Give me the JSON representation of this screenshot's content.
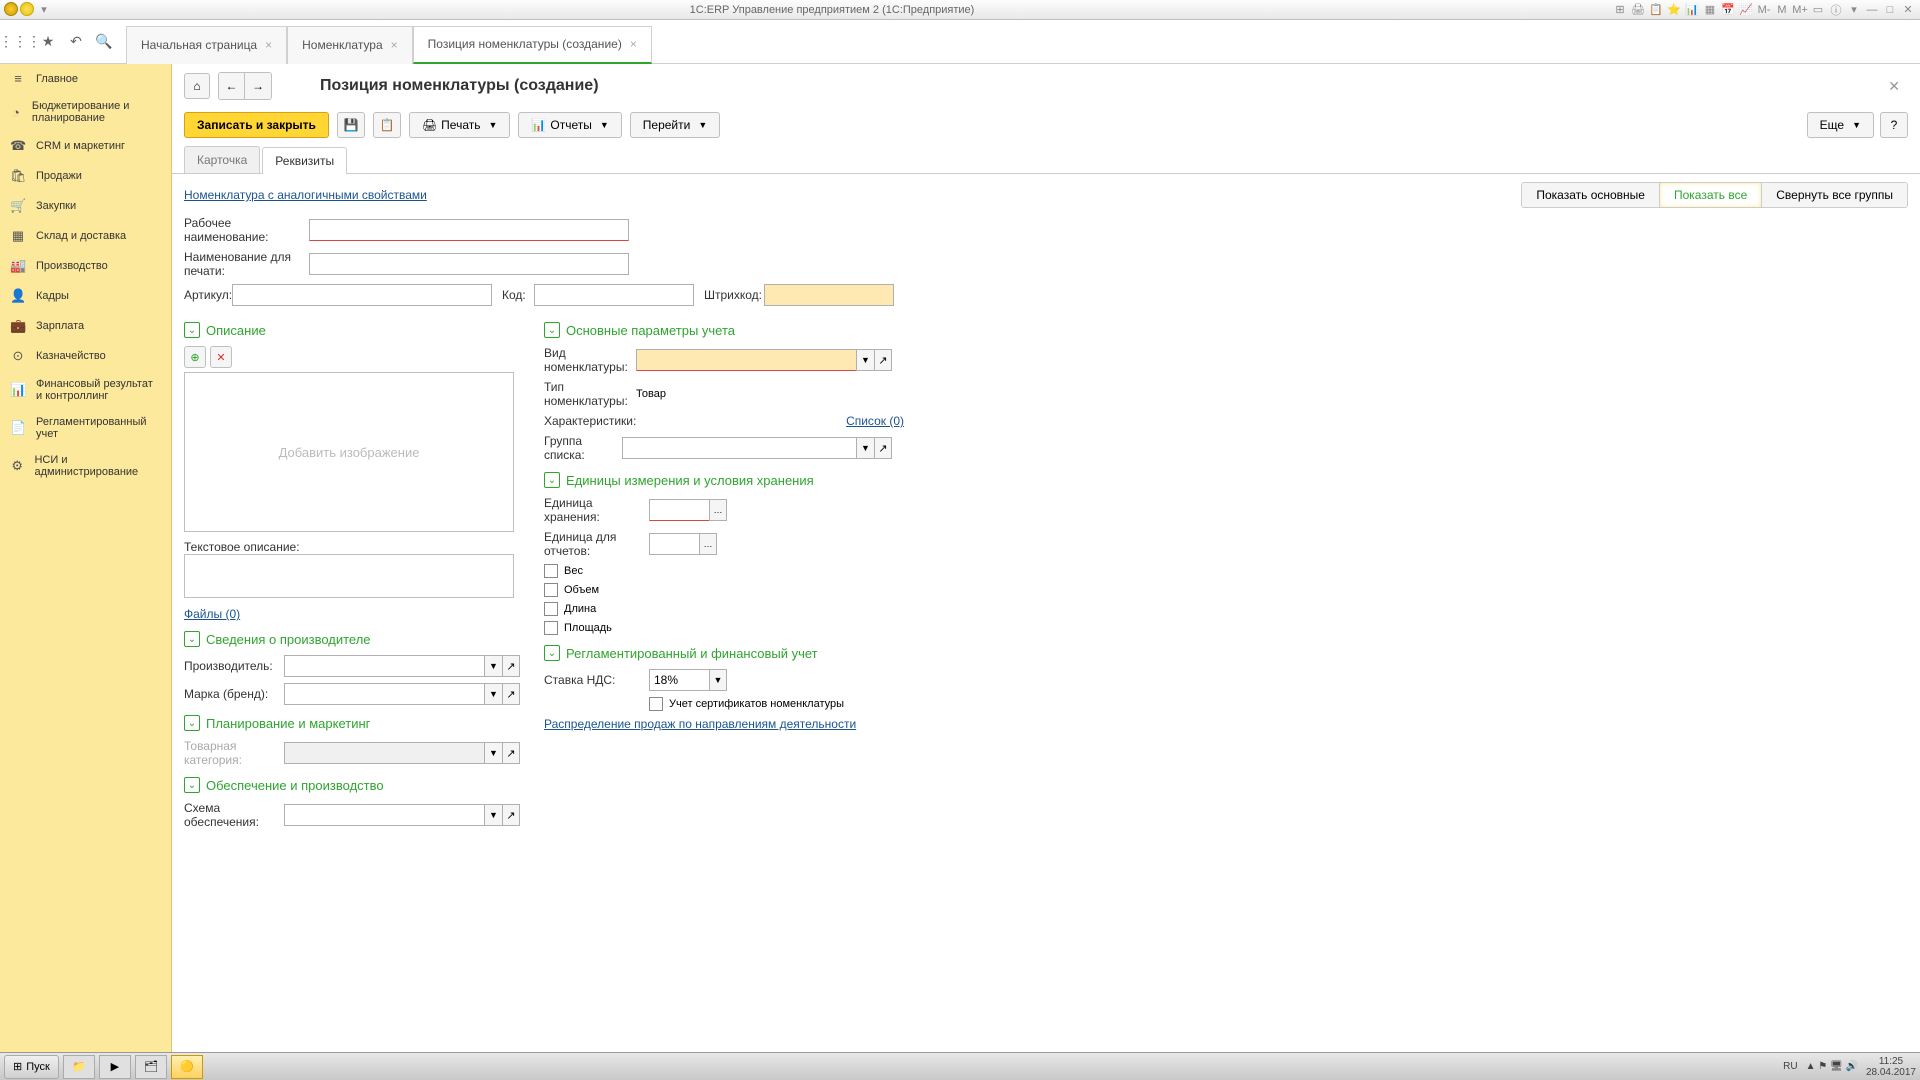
{
  "titlebar": {
    "title": "1С:ERP Управление предприятием 2  (1С:Предприятие)",
    "right_icons": [
      "⊞",
      "🖨",
      "📋",
      "⭐",
      "📊",
      "▦",
      "📅",
      "📈",
      "M-",
      "M",
      "M+",
      "▭",
      "ⓘ",
      "▾",
      "—",
      "□",
      "✕"
    ]
  },
  "iconbar_tabs": [
    {
      "label": "Начальная страница",
      "closable": true
    },
    {
      "label": "Номенклатура",
      "closable": true
    },
    {
      "label": "Позиция номенклатуры (создание)",
      "closable": true,
      "active": true
    }
  ],
  "sidebar": [
    {
      "icon": "≡",
      "label": "Главное"
    },
    {
      "icon": "◔",
      "label": "Бюджетирование и планирование"
    },
    {
      "icon": "☎",
      "label": "CRM и маркетинг"
    },
    {
      "icon": "🛍",
      "label": "Продажи"
    },
    {
      "icon": "🛒",
      "label": "Закупки"
    },
    {
      "icon": "▦",
      "label": "Склад и доставка"
    },
    {
      "icon": "🏭",
      "label": "Производство"
    },
    {
      "icon": "👤",
      "label": "Кадры"
    },
    {
      "icon": "💼",
      "label": "Зарплата"
    },
    {
      "icon": "⊙",
      "label": "Казначейство"
    },
    {
      "icon": "📊",
      "label": "Финансовый результат и контроллинг"
    },
    {
      "icon": "📄",
      "label": "Регламентированный учет"
    },
    {
      "icon": "⚙",
      "label": "НСИ и администрирование"
    }
  ],
  "page": {
    "title": "Позиция номенклатуры (создание)",
    "save_close": "Записать и закрыть",
    "print": "Печать",
    "reports": "Отчеты",
    "goto": "Перейти",
    "more": "Еще",
    "help": "?"
  },
  "subtabs": {
    "card": "Карточка",
    "req": "Реквизиты"
  },
  "toplink": "Номенклатура с аналогичными свойствами",
  "view": {
    "main": "Показать основные",
    "all": "Показать все",
    "collapse": "Свернуть все группы"
  },
  "labels": {
    "work_name": "Рабочее наименование:",
    "print_name": "Наименование для печати:",
    "article": "Артикул:",
    "code": "Код:",
    "barcode": "Штрихкод:",
    "text_desc": "Текстовое описание:",
    "files": "Файлы (0)",
    "manufacturer": "Производитель:",
    "brand": "Марка (бренд):",
    "category": "Товарная категория:",
    "supply": "Схема обеспечения:",
    "kind": "Вид номенклатуры:",
    "type": "Тип номенклатуры:",
    "type_val": "Товар",
    "characteristics": "Характеристики:",
    "char_link": "Список (0)",
    "list_group": "Группа списка:",
    "storage_unit": "Единица хранения:",
    "report_unit": "Единица для отчетов:",
    "weight": "Вес",
    "volume": "Объем",
    "length": "Длина",
    "area": "Площадь",
    "vat": "Ставка НДС:",
    "vat_val": "18%",
    "cert": "Учет сертификатов номенклатуры",
    "sales_link": "Распределение продаж по направлениям деятельности",
    "add_image": "Добавить изображение"
  },
  "sections": {
    "desc": "Описание",
    "manufacturer": "Сведения о производителе",
    "planning": "Планирование и маркетинг",
    "supply": "Обеспечение и производство",
    "main_params": "Основные параметры учета",
    "units": "Единицы измерения и условия хранения",
    "finance": "Регламентированный и финансовый учет"
  },
  "taskbar": {
    "start": "Пуск",
    "lang": "RU",
    "time": "11:25",
    "date": "28.04.2017"
  }
}
